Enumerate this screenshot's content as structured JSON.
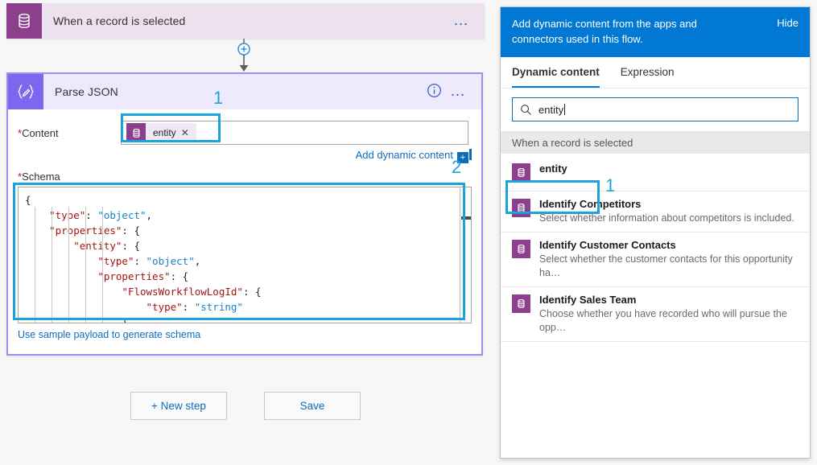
{
  "designer": {
    "trigger": {
      "title": "When a record is selected",
      "icon": "database-icon",
      "overflow": "…"
    },
    "connector": {
      "add_icon": "plus-circle-icon"
    },
    "parse_json": {
      "title": "Parse JSON",
      "icon": "braces-pencil-icon",
      "info_icon": "info-icon",
      "overflow": "…",
      "content": {
        "label": "Content",
        "required_marker": "*",
        "token_label": "entity",
        "token_icon": "database-icon",
        "token_remove": "✕"
      },
      "add_dynamic_content": {
        "label": "Add dynamic content",
        "plus": "+"
      },
      "schema": {
        "label": "Schema",
        "required_marker": "*",
        "lines": [
          {
            "indent": 0,
            "parts": [
              {
                "t": "pun",
                "v": "{"
              }
            ]
          },
          {
            "indent": 2,
            "parts": [
              {
                "t": "key",
                "v": "\"type\""
              },
              {
                "t": "pun",
                "v": ": "
              },
              {
                "t": "str",
                "v": "\"object\""
              },
              {
                "t": "pun",
                "v": ","
              }
            ]
          },
          {
            "indent": 2,
            "parts": [
              {
                "t": "key",
                "v": "\"properties\""
              },
              {
                "t": "pun",
                "v": ": {"
              }
            ]
          },
          {
            "indent": 4,
            "parts": [
              {
                "t": "key",
                "v": "\"entity\""
              },
              {
                "t": "pun",
                "v": ": {"
              }
            ]
          },
          {
            "indent": 6,
            "parts": [
              {
                "t": "key",
                "v": "\"type\""
              },
              {
                "t": "pun",
                "v": ": "
              },
              {
                "t": "str",
                "v": "\"object\""
              },
              {
                "t": "pun",
                "v": ","
              }
            ]
          },
          {
            "indent": 6,
            "parts": [
              {
                "t": "key",
                "v": "\"properties\""
              },
              {
                "t": "pun",
                "v": ": {"
              }
            ]
          },
          {
            "indent": 8,
            "parts": [
              {
                "t": "key",
                "v": "\"FlowsWorkflowLogId\""
              },
              {
                "t": "pun",
                "v": ": {"
              }
            ]
          },
          {
            "indent": 10,
            "parts": [
              {
                "t": "key",
                "v": "\"type\""
              },
              {
                "t": "pun",
                "v": ": "
              },
              {
                "t": "str",
                "v": "\"string\""
              }
            ]
          },
          {
            "indent": 8,
            "parts": [
              {
                "t": "pun",
                "v": "},"
              }
            ]
          },
          {
            "indent": 8,
            "parts": [
              {
                "t": "key",
                "v": "\""
              },
              {
                "t": "pun",
                "v": "            "
              },
              {
                "t": "str",
                "v": "\""
              }
            ]
          }
        ],
        "sample_payload_link": "Use sample payload to generate schema"
      }
    },
    "buttons": {
      "new_step": "+ New step",
      "save": "Save"
    }
  },
  "flyout": {
    "header": {
      "text": "Add dynamic content from the apps and connectors used in this flow.",
      "hide": "Hide"
    },
    "tabs": [
      {
        "label": "Dynamic content",
        "active": true
      },
      {
        "label": "Expression",
        "active": false
      }
    ],
    "search": {
      "value": "entity",
      "icon": "search-icon"
    },
    "group_header": "When a record is selected",
    "items": [
      {
        "title": "entity",
        "desc": "",
        "icon": "database-icon"
      },
      {
        "title": "Identify Competitors",
        "desc": "Select whether information about competitors is included.",
        "icon": "database-icon"
      },
      {
        "title": "Identify Customer Contacts",
        "desc": "Select whether the customer contacts for this opportunity ha…",
        "icon": "database-icon"
      },
      {
        "title": "Identify Sales Team",
        "desc": "Choose whether you have recorded who will pursue the opp…",
        "icon": "database-icon"
      }
    ]
  },
  "annotations": [
    {
      "label": "1"
    },
    {
      "label": "2"
    },
    {
      "label": "1"
    }
  ],
  "colors": {
    "accent_blue": "#0078d4",
    "highlight_cyan": "#19a5dc",
    "dataverse_purple": "#8c3f8c",
    "parse_json_purple": "#7b68ee",
    "link_blue": "#0f6cbd"
  }
}
